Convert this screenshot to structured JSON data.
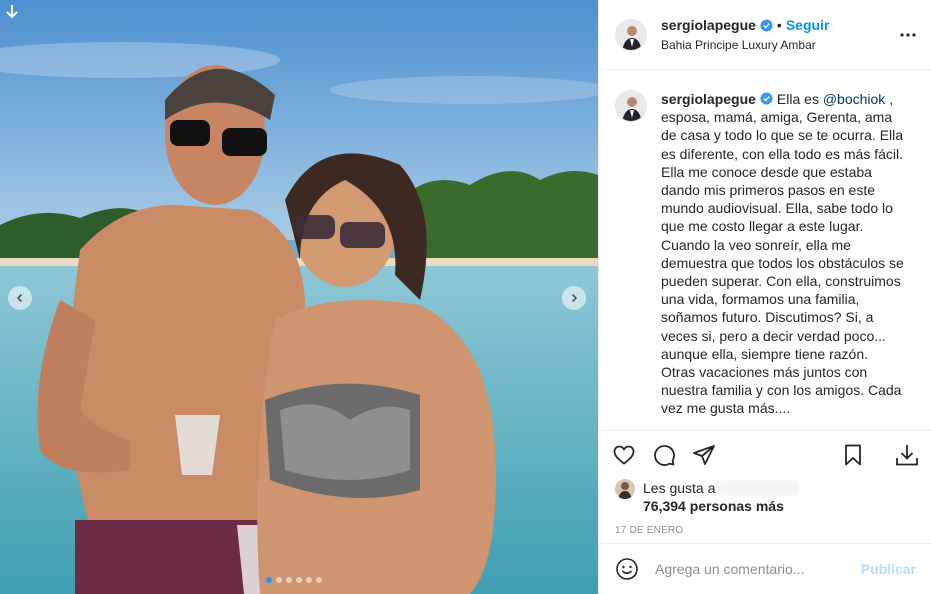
{
  "photo": {
    "alt_icons": {
      "download": "download-arrow-icon",
      "prev": "chevron-left-icon",
      "next": "chevron-right-icon"
    },
    "carousel": {
      "count": 6,
      "active_index": 0
    }
  },
  "header": {
    "username": "sergiolapegue",
    "separator": "•",
    "follow_label": "Seguir",
    "location": "Bahia Principe Luxury Ambar",
    "verified_icon": "verified-badge-icon",
    "more_icon": "more-options-icon"
  },
  "caption": {
    "username": "sergiolapegue",
    "text_before": "Ella es ",
    "mention": "@bochiok",
    "text_after": " , esposa, mamá, amiga, Gerenta, ama de casa y todo lo que se te ocurra. Ella es diferente, con ella todo es más fácil. Ella me conoce desde que estaba dando mis primeros pasos en este mundo audiovisual. Ella, sabe todo lo que me costo llegar a este lugar. Cuando la veo sonreír, ella me demuestra que todos los obstáculos se pueden superar. Con ella, construimos una vida, formamos una familia, soñamos futuro. Discutimos? Si, a veces si, pero a decir verdad poco... aunque ella, siempre tiene razón. Otras vacaciones más juntos con nuestra familia y con los amigos. Cada vez me gusta más...."
  },
  "actions": {
    "icons": [
      "heart-icon",
      "comment-icon",
      "share-icon",
      "bookmark-icon",
      "download-icon"
    ]
  },
  "likes": {
    "prefix": "Les gusta a",
    "count_text": "76,394 personas más"
  },
  "date": "17 DE ENERO",
  "comment_box": {
    "placeholder": "Agrega un comentario...",
    "publish_label": "Publicar"
  },
  "colors": {
    "accent": "#0095f6",
    "publish_disabled": "#b2dffc",
    "mention": "#00376b",
    "border": "#efefef",
    "muted": "#8e8e8e"
  }
}
